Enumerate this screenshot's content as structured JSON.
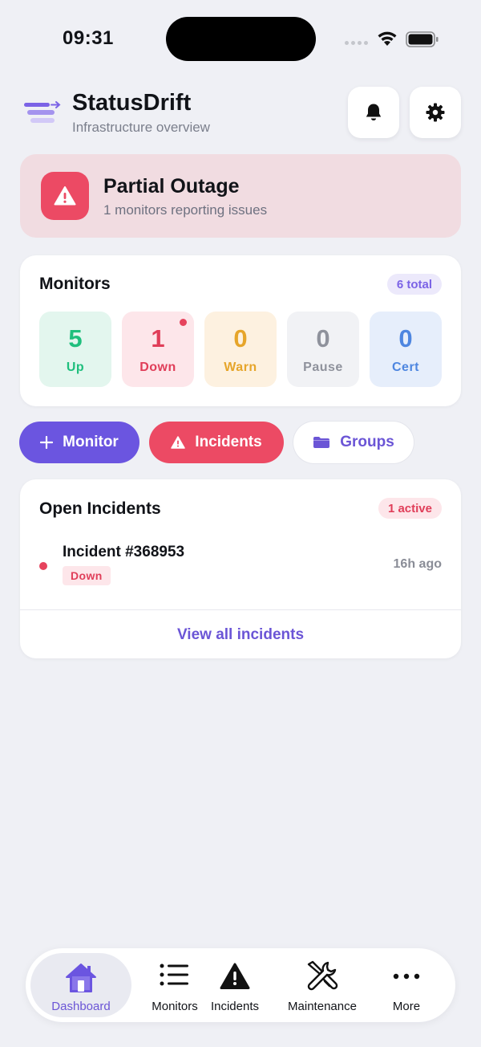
{
  "status_bar": {
    "time": "09:31"
  },
  "header": {
    "title": "StatusDrift",
    "subtitle": "Infrastructure overview"
  },
  "outage": {
    "title": "Partial Outage",
    "subtitle": "1 monitors reporting issues"
  },
  "monitors": {
    "title": "Monitors",
    "total_badge": "6 total",
    "stats": [
      {
        "value": "5",
        "label": "Up",
        "color": "#1fbf7d",
        "bg": "#e3f6ee"
      },
      {
        "value": "1",
        "label": "Down",
        "color": "#e03e59",
        "bg": "#fde6ea"
      },
      {
        "value": "0",
        "label": "Warn",
        "color": "#e6a52a",
        "bg": "#fdf1e0"
      },
      {
        "value": "0",
        "label": "Pause",
        "color": "#8f929c",
        "bg": "#f1f2f5"
      },
      {
        "value": "0",
        "label": "Cert",
        "color": "#4e86e0",
        "bg": "#e6eefb"
      }
    ]
  },
  "actions": {
    "monitor": "Monitor",
    "incidents": "Incidents",
    "groups": "Groups"
  },
  "open_incidents": {
    "title": "Open Incidents",
    "active_badge": "1 active",
    "items": [
      {
        "title": "Incident #368953",
        "status": "Down",
        "time": "16h ago"
      }
    ],
    "view_all": "View all incidents"
  },
  "nav": {
    "dashboard": "Dashboard",
    "monitors": "Monitors",
    "incidents": "Incidents",
    "maintenance": "Maintenance",
    "more": "More"
  },
  "colors": {
    "accent": "#6b55d6",
    "danger": "#ec4a64",
    "background": "#eff0f5"
  }
}
